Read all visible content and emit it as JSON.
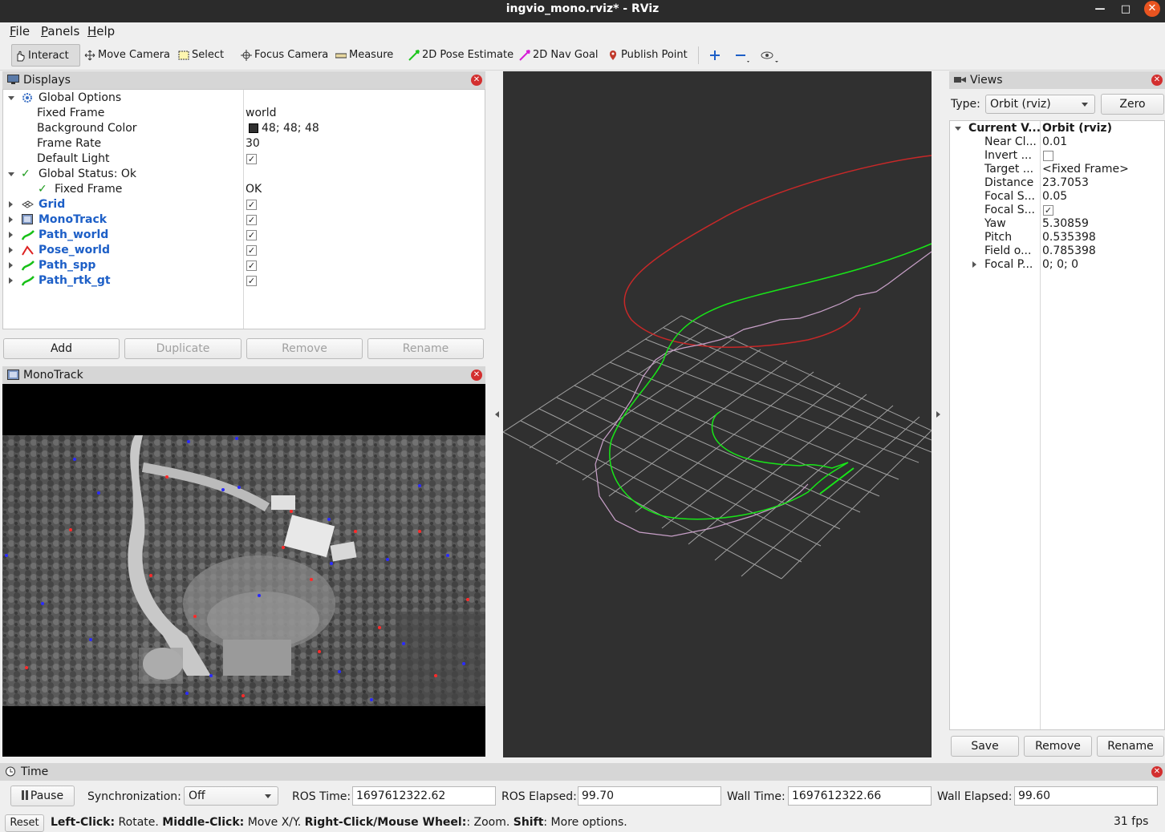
{
  "window": {
    "title": "ingvio_mono.rviz* - RViz"
  },
  "menu": [
    "File",
    "Panels",
    "Help"
  ],
  "toolbar": {
    "interact": "Interact",
    "move_camera": "Move Camera",
    "select": "Select",
    "focus_camera": "Focus Camera",
    "measure": "Measure",
    "pose_estimate": "2D Pose Estimate",
    "nav_goal": "2D Nav Goal",
    "publish_point": "Publish Point"
  },
  "displays": {
    "title": "Displays",
    "global_options": "Global Options",
    "fixed_frame_label": "Fixed Frame",
    "fixed_frame_value": "world",
    "bg_color_label": "Background Color",
    "bg_color_value": "48; 48; 48",
    "frame_rate_label": "Frame Rate",
    "frame_rate_value": "30",
    "default_light_label": "Default Light",
    "global_status": "Global Status: Ok",
    "status_fixed_frame": "Fixed Frame",
    "status_fixed_frame_value": "OK",
    "items": [
      "Grid",
      "MonoTrack",
      "Path_world",
      "Pose_world",
      "Path_spp",
      "Path_rtk_gt"
    ],
    "buttons": {
      "add": "Add",
      "duplicate": "Duplicate",
      "remove": "Remove",
      "rename": "Rename"
    }
  },
  "monotrack": {
    "title": "MonoTrack"
  },
  "views": {
    "title": "Views",
    "type_label": "Type:",
    "type_value": "Orbit (rviz)",
    "zero": "Zero",
    "current_label": "Current V...",
    "current_value": "Orbit (rviz)",
    "props": [
      {
        "k": "Near Cl...",
        "v": "0.01"
      },
      {
        "k": "Invert ...",
        "v": ""
      },
      {
        "k": "Target ...",
        "v": "<Fixed Frame>"
      },
      {
        "k": "Distance",
        "v": "23.7053"
      },
      {
        "k": "Focal S...",
        "v": "0.05"
      },
      {
        "k": "Focal S...",
        "v": ""
      },
      {
        "k": "Yaw",
        "v": "5.30859"
      },
      {
        "k": "Pitch",
        "v": "0.535398"
      },
      {
        "k": "Field o...",
        "v": "0.785398"
      },
      {
        "k": "Focal P...",
        "v": "0; 0; 0"
      }
    ],
    "buttons": {
      "save": "Save",
      "remove": "Remove",
      "rename": "Rename"
    }
  },
  "time": {
    "title": "Time",
    "pause": "Pause",
    "sync_label": "Synchronization:",
    "sync_value": "Off",
    "ros_time_label": "ROS Time:",
    "ros_time": "1697612322.62",
    "ros_elapsed_label": "ROS Elapsed:",
    "ros_elapsed": "99.70",
    "wall_time_label": "Wall Time:",
    "wall_time": "1697612322.66",
    "wall_elapsed_label": "Wall Elapsed:",
    "wall_elapsed": "99.60"
  },
  "status": {
    "reset": "Reset",
    "hint_b1": "Left-Click:",
    "hint_t1": " Rotate. ",
    "hint_b2": "Middle-Click:",
    "hint_t2": " Move X/Y. ",
    "hint_b3": "Right-Click/Mouse Wheel:",
    "hint_t3": ": Zoom. ",
    "hint_b4": "Shift",
    "hint_t4": ": More options.",
    "fps": "31 fps"
  },
  "colors": {
    "viewport_bg": "#303030",
    "path_green": "#18e618",
    "pose_red": "#c82828",
    "path_pink": "#c8a0c8",
    "grid": "#a0a0a0"
  }
}
